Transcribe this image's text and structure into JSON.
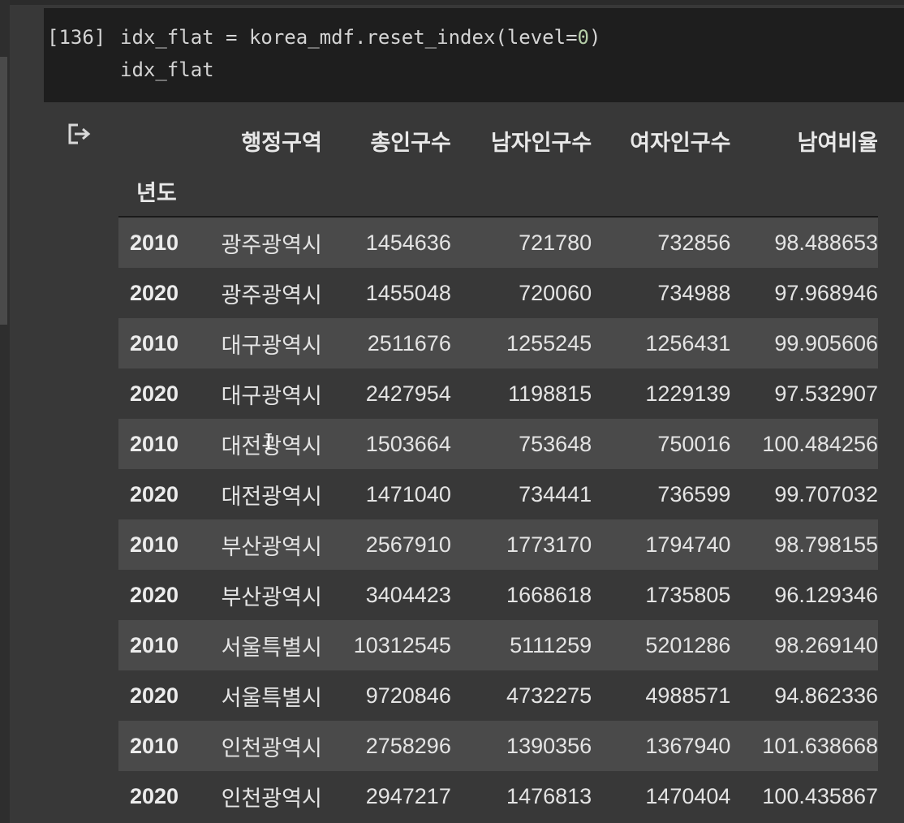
{
  "cell": {
    "exec_count": "[136]",
    "code_line_1_prefix": "idx_flat = korea_mdf.reset_index(level=",
    "code_line_1_num": "0",
    "code_line_1_suffix": ")",
    "code_line_2": "idx_flat"
  },
  "output": {
    "icon": "output-redirect-icon",
    "columns": [
      "행정구역",
      "총인구수",
      "남자인구수",
      "여자인구수",
      "남여비율"
    ],
    "index_name": "년도",
    "rows": [
      {
        "year": "2010",
        "region": "광주광역시",
        "total": "1454636",
        "male": "721780",
        "female": "732856",
        "ratio": "98.488653"
      },
      {
        "year": "2020",
        "region": "광주광역시",
        "total": "1455048",
        "male": "720060",
        "female": "734988",
        "ratio": "97.968946"
      },
      {
        "year": "2010",
        "region": "대구광역시",
        "total": "2511676",
        "male": "1255245",
        "female": "1256431",
        "ratio": "99.905606"
      },
      {
        "year": "2020",
        "region": "대구광역시",
        "total": "2427954",
        "male": "1198815",
        "female": "1229139",
        "ratio": "97.532907"
      },
      {
        "year": "2010",
        "region": "대전광역시",
        "total": "1503664",
        "male": "753648",
        "female": "750016",
        "ratio": "100.484256"
      },
      {
        "year": "2020",
        "region": "대전광역시",
        "total": "1471040",
        "male": "734441",
        "female": "736599",
        "ratio": "99.707032"
      },
      {
        "year": "2010",
        "region": "부산광역시",
        "total": "2567910",
        "male": "1773170",
        "female": "1794740",
        "ratio": "98.798155"
      },
      {
        "year": "2020",
        "region": "부산광역시",
        "total": "3404423",
        "male": "1668618",
        "female": "1735805",
        "ratio": "96.129346"
      },
      {
        "year": "2010",
        "region": "서울특별시",
        "total": "10312545",
        "male": "5111259",
        "female": "5201286",
        "ratio": "98.269140"
      },
      {
        "year": "2020",
        "region": "서울특별시",
        "total": "9720846",
        "male": "4732275",
        "female": "4988571",
        "ratio": "94.862336"
      },
      {
        "year": "2010",
        "region": "인천광역시",
        "total": "2758296",
        "male": "1390356",
        "female": "1367940",
        "ratio": "101.638668"
      },
      {
        "year": "2020",
        "region": "인천광역시",
        "total": "2947217",
        "male": "1476813",
        "female": "1470404",
        "ratio": "100.435867"
      }
    ]
  },
  "colors": {
    "background": "#383838",
    "code_background": "#1e1e1e",
    "row_stripe": "#4a4a4a",
    "text": "#e4e4e4"
  }
}
